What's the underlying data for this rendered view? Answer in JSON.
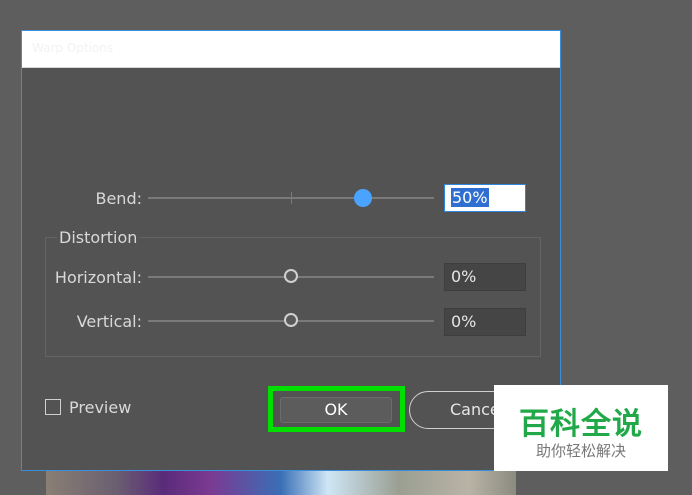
{
  "dialog": {
    "title": "Warp Options"
  },
  "bend": {
    "label": "Bend:",
    "value": "50%",
    "slider_fraction": 0.75
  },
  "distortion": {
    "group_label": "Distortion",
    "horizontal": {
      "label": "Horizontal:",
      "value": "0%",
      "slider_fraction": 0.5
    },
    "vertical": {
      "label": "Vertical:",
      "value": "0%",
      "slider_fraction": 0.5
    }
  },
  "footer": {
    "preview_label": "Preview",
    "preview_checked": false,
    "ok_label": "OK",
    "cancel_label": "Cancel"
  },
  "watermark": {
    "main": "百科全说",
    "sub": "助你轻松解决"
  },
  "colors": {
    "highlight": "#00e000",
    "accent": "#4aa3ff",
    "watermark_green": "#21a848"
  }
}
